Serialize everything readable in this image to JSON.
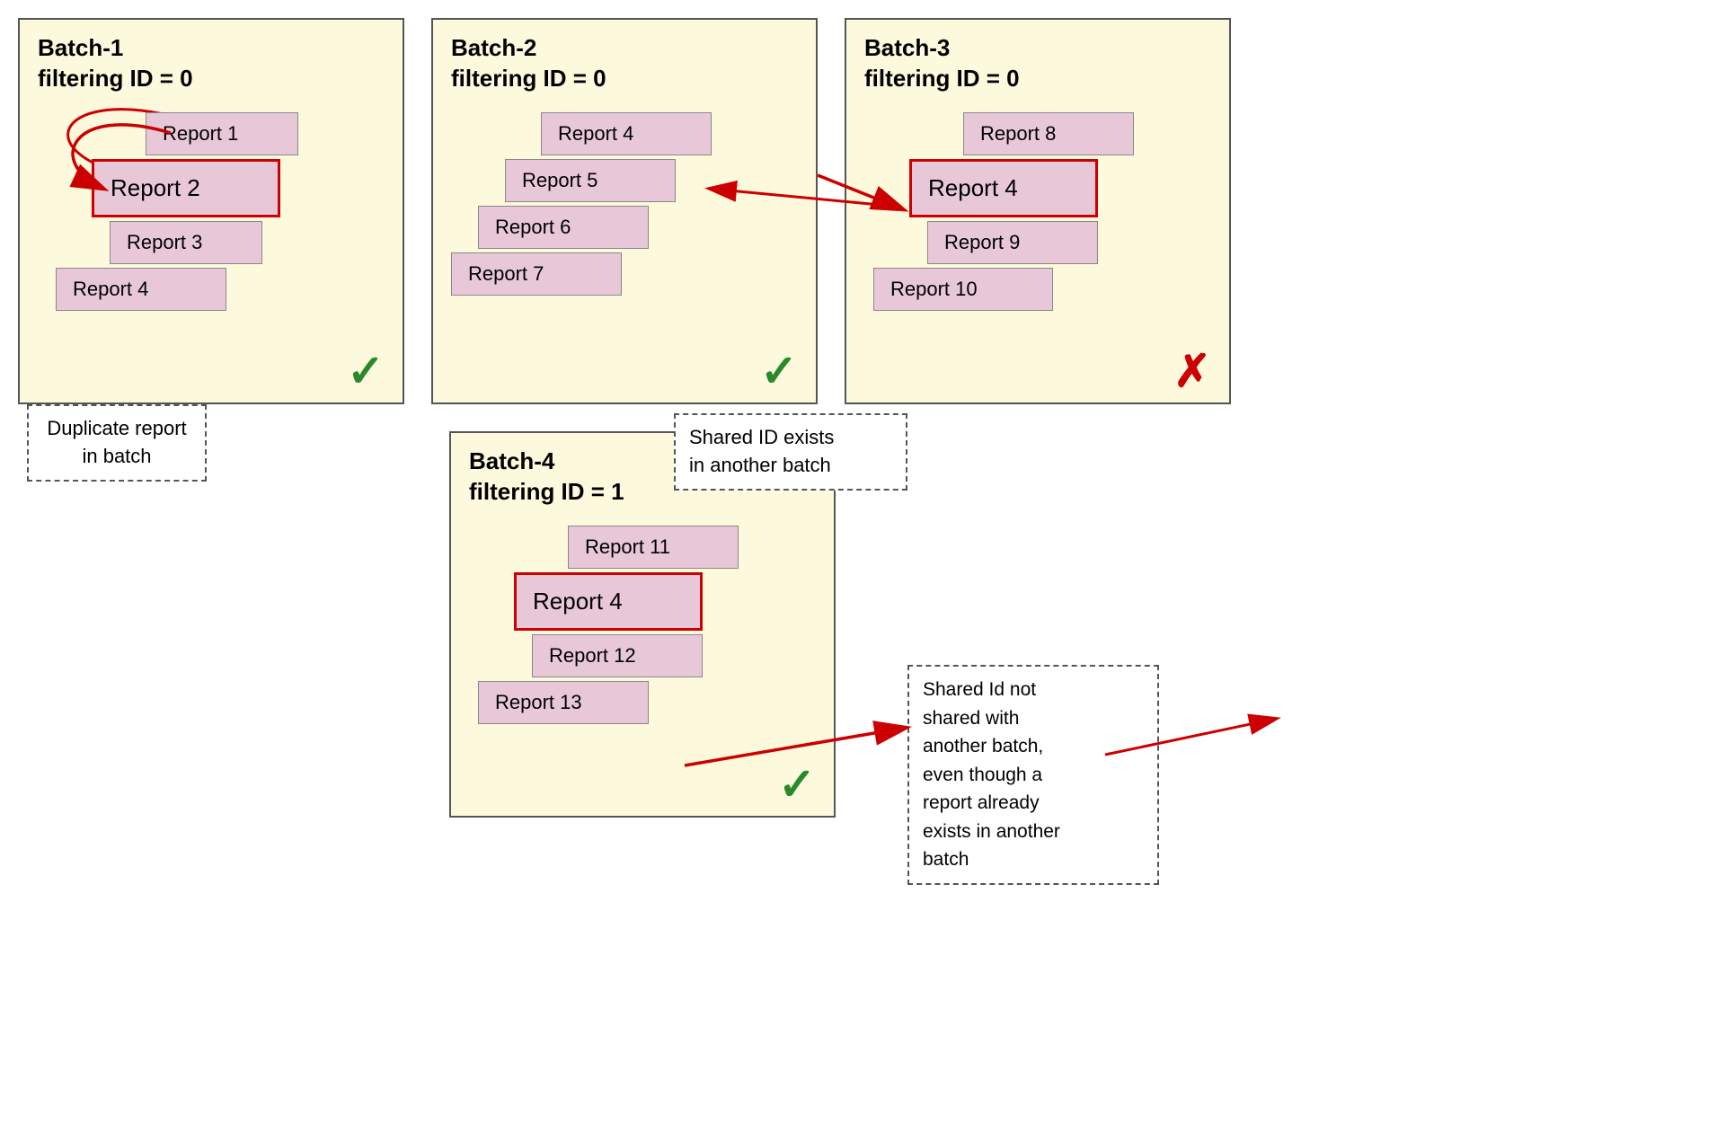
{
  "batches": {
    "batch1": {
      "title": "Batch-1",
      "subtitle": "filtering ID = 0",
      "reports": [
        "Report 1",
        "Report 2",
        "Report 3",
        "Report 4"
      ],
      "highlighted_index": 1,
      "result": "check",
      "annotation": "Duplicate report\nin batch"
    },
    "batch2": {
      "title": "Batch-2",
      "subtitle": "filtering ID = 0",
      "reports": [
        "Report 4",
        "Report 5",
        "Report 6",
        "Report 7"
      ],
      "highlighted_index": -1,
      "result": "check",
      "annotation": null
    },
    "batch3": {
      "title": "Batch-3",
      "subtitle": "filtering ID = 0",
      "reports": [
        "Report 8",
        "Report 4",
        "Report 9",
        "Report 10"
      ],
      "highlighted_index": 1,
      "result": "x",
      "annotation": "Shared ID exists\nin another batch"
    },
    "batch4": {
      "title": "Batch-4",
      "subtitle": "filtering ID = 1",
      "reports": [
        "Report 11",
        "Report 4",
        "Report 12",
        "Report 13"
      ],
      "highlighted_index": 1,
      "result": "check",
      "annotation": "Shared Id not\nshared with\nanother batch,\neven though a\nreport already\nexists in another\nbatch"
    }
  },
  "colors": {
    "batch_bg": "#fdf9dc",
    "batch_border": "#555555",
    "report_bg": "#e8c8d8",
    "highlight_border": "#cc0000",
    "check_color": "#2a8a2a",
    "x_color": "#cc0000",
    "annotation_border": "#555555"
  }
}
